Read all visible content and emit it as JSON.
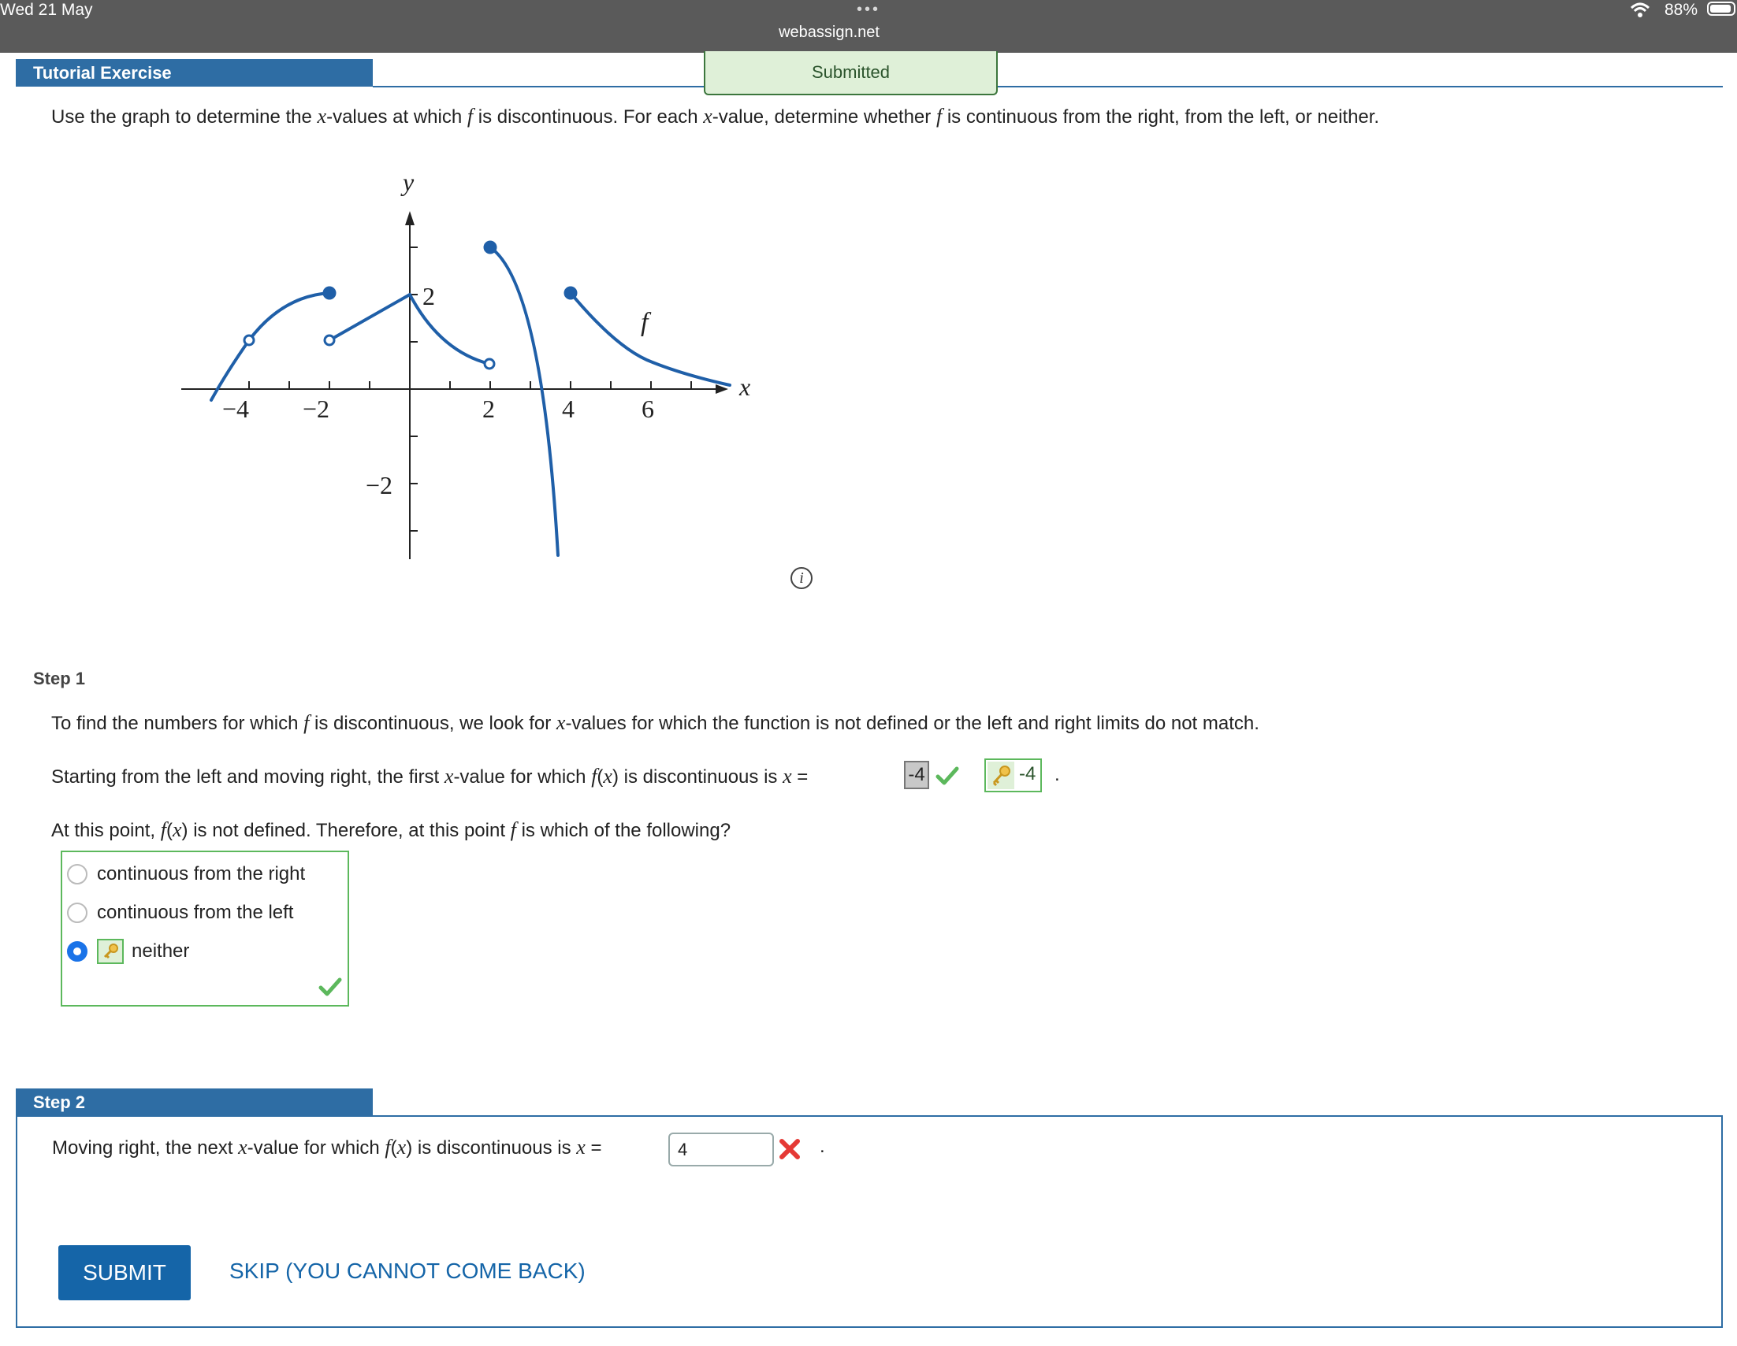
{
  "status_bar": {
    "date": "Wed 21 May",
    "url": "webassign.net",
    "dots": "•••",
    "battery": "88%"
  },
  "header": {
    "title": "Tutorial Exercise",
    "badge": "Submitted"
  },
  "question": {
    "p1": "Use the graph to determine the ",
    "var_x1": "x",
    "p2": "-values at which ",
    "var_f1": "f",
    "p3": " is discontinuous. For each ",
    "var_x2": "x",
    "p4": "-value, determine whether ",
    "var_f2": "f",
    "p5": " is continuous from the right, from the left, or neither."
  },
  "graph": {
    "y_label": "y",
    "x_label": "x",
    "f_label": "f",
    "x_ticks": [
      "−4",
      "−2",
      "2",
      "4",
      "6"
    ],
    "y_ticks": [
      "2",
      "−2"
    ],
    "info_icon": "i"
  },
  "step1": {
    "title": "Step 1",
    "intro_a": "To find the numbers for which ",
    "intro_f": "f",
    "intro_b": " is discontinuous, we look for ",
    "intro_x": "x",
    "intro_c": "-values for which the function is not defined or the left and right limits do not match.",
    "line2_a": "Starting from the left and moving right, the first ",
    "line2_x": "x",
    "line2_b": "-value for which ",
    "line2_f": "f",
    "line2_c": "(",
    "line2_x2": "x",
    "line2_d": ") is discontinuous is ",
    "line2_x3": "x",
    "line2_e": " = ",
    "answer": "-4",
    "key_answer": "-4",
    "period": ".",
    "line3_a": "At this point, ",
    "line3_f": "f",
    "line3_b": "(",
    "line3_x": "x",
    "line3_c": ") is not defined. Therefore, at this point ",
    "line3_f2": "f",
    "line3_d": " is which of the following?",
    "options": [
      "continuous from the right",
      "continuous from the left",
      "neither"
    ],
    "selected": "neither"
  },
  "step2": {
    "title": "Step 2",
    "text_a": "Moving right, the next ",
    "text_x": "x",
    "text_b": "-value for which ",
    "text_f": "f",
    "text_c": "(",
    "text_x2": "x",
    "text_d": ") is discontinuous is ",
    "text_x3": "x",
    "text_e": " = ",
    "input_value": "4",
    "period": ".",
    "submit": "SUBMIT",
    "skip": "SKIP (YOU CANNOT COME BACK)"
  },
  "colors": {
    "header_blue": "#2e6da4",
    "correct_green": "#5cb85c",
    "wrong_red": "#e53935",
    "curve_blue": "#1f5fa8"
  }
}
